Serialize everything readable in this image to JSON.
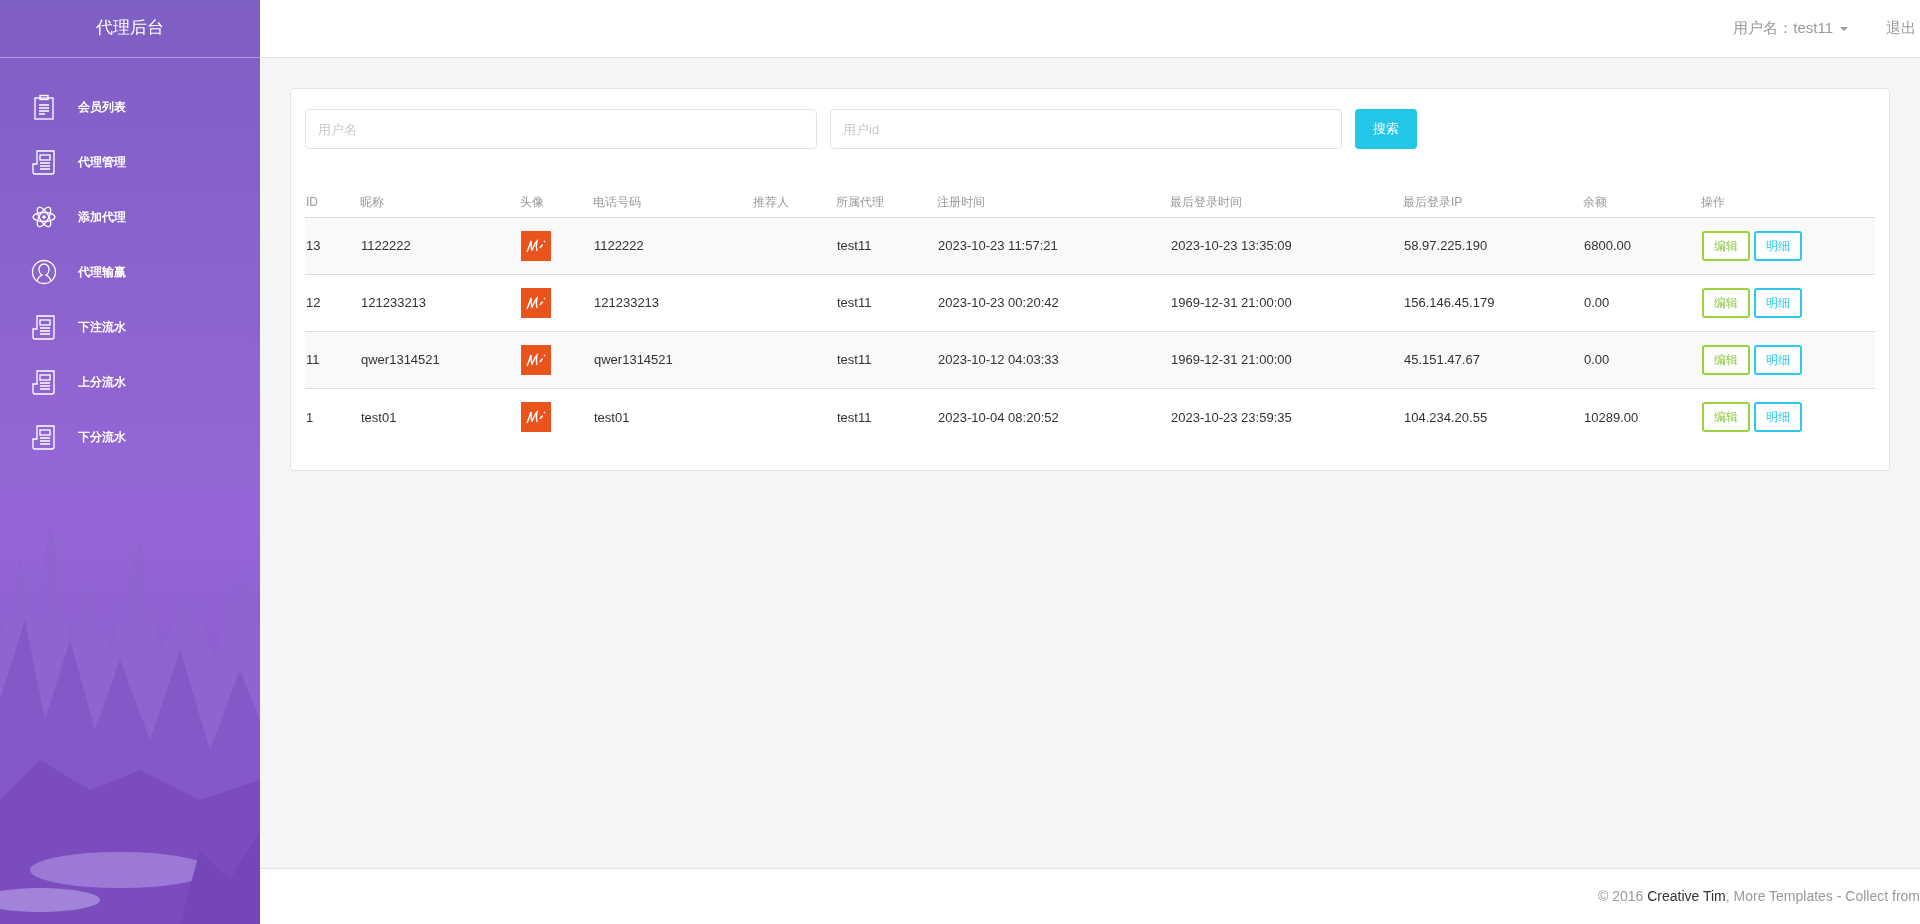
{
  "sidebar": {
    "title": "代理后台",
    "items": [
      {
        "label": "会员列表",
        "kind": "clipboard"
      },
      {
        "label": "代理管理",
        "kind": "newspaper"
      },
      {
        "label": "添加代理",
        "kind": "atom"
      },
      {
        "label": "代理输赢",
        "kind": "user"
      },
      {
        "label": "下注流水",
        "kind": "newspaper"
      },
      {
        "label": "上分流水",
        "kind": "newspaper"
      },
      {
        "label": "下分流水",
        "kind": "newspaper"
      }
    ]
  },
  "topbar": {
    "user_menu": "用户名：test11",
    "logout": "退出"
  },
  "search": {
    "fields": [
      {
        "placeholder": "用户名"
      },
      {
        "placeholder": "用户id"
      }
    ],
    "button": "搜索"
  },
  "table": {
    "columns": [
      "ID",
      "昵称",
      "头像",
      "电话号码",
      "推荐人",
      "所属代理",
      "注册时间",
      "最后登录时间",
      "最后登录IP",
      "余额",
      "操作"
    ],
    "rows": [
      {
        "id": "13",
        "nickname": "1122222",
        "phone": "1122222",
        "referrer": "",
        "agent": "test11",
        "registered": "2023-10-23 11:57:21",
        "last_login": "2023-10-23 13:35:09",
        "ip": "58.97.225.190",
        "balance": "6800.00",
        "actions": [
          "编辑",
          "明细"
        ]
      },
      {
        "id": "12",
        "nickname": "121233213",
        "phone": "121233213",
        "referrer": "",
        "agent": "test11",
        "registered": "2023-10-23 00:20:42",
        "last_login": "1969-12-31 21:00:00",
        "ip": "156.146.45.179",
        "balance": "0.00",
        "actions": [
          "编辑",
          "明细"
        ]
      },
      {
        "id": "11",
        "nickname": "qwer1314521",
        "phone": "qwer1314521",
        "referrer": "",
        "agent": "test11",
        "registered": "2023-10-12 04:03:33",
        "last_login": "1969-12-31 21:00:00",
        "ip": "45.151.47.67",
        "balance": "0.00",
        "actions": [
          "编辑",
          "明细"
        ]
      },
      {
        "id": "1",
        "nickname": "test01",
        "phone": "test01",
        "referrer": "",
        "agent": "test11",
        "registered": "2023-10-04 08:20:52",
        "last_login": "2023-10-23 23:59:35",
        "ip": "104.234.20.55",
        "balance": "10289.00",
        "actions": [
          "编辑",
          "明细"
        ]
      }
    ]
  },
  "footer": {
    "prefix": "© 2016 ",
    "link": "Creative Tim",
    "suffix": ", More Templates - Collect from"
  }
}
